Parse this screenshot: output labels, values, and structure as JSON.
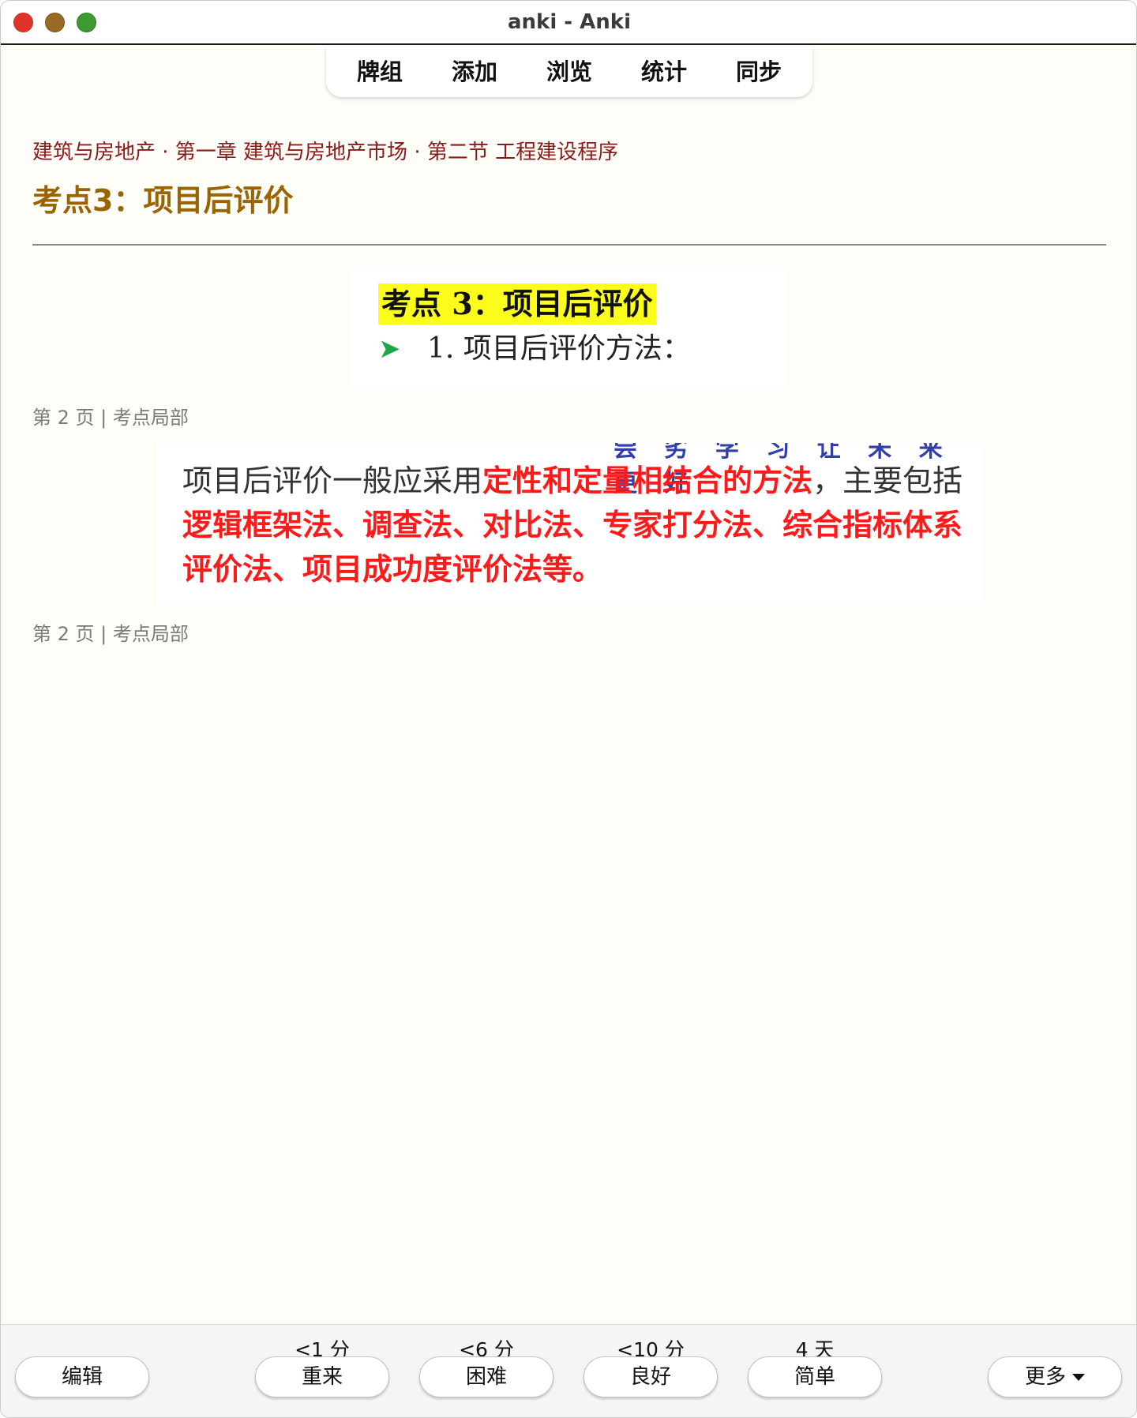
{
  "window": {
    "title": "anki - Anki"
  },
  "topbar": {
    "tabs": [
      "牌组",
      "添加",
      "浏览",
      "统计",
      "同步"
    ]
  },
  "card": {
    "breadcrumb": "建筑与房地产 · 第一章 建筑与房地产市场 · 第二节 工程建设程序",
    "title": "考点3：项目后评价",
    "image1": {
      "heading": "考点 3：项目后评价",
      "line": "1.  项目后评价方法："
    },
    "caption1": "第 2 页 | 考点局部",
    "image2": {
      "cut_top": "尝 劣 学 习   让 未 来 更 好",
      "text_a": "项目后评价一般应采用",
      "red_a": "定性和定量相结合的方法",
      "text_b": "，主要包括",
      "red_b": "逻辑框架法、调查法、对比法、专家打分法、综合指标体系评价法、项目成功度评价法等。"
    },
    "caption2": "第 2 页 | 考点局部"
  },
  "bottombar": {
    "edit_label": "编辑",
    "answers": [
      {
        "interval": "<1 分",
        "label": "重来"
      },
      {
        "interval": "<6 分",
        "label": "困难"
      },
      {
        "interval": "<10 分",
        "label": "良好"
      },
      {
        "interval": "4 天",
        "label": "简单"
      }
    ],
    "more_label": "更多"
  },
  "colors": {
    "breadcrumb": "#8b1a1a",
    "title": "#9a6400",
    "highlight": "#fbfb1c",
    "emphasis": "#ff1a1a"
  }
}
